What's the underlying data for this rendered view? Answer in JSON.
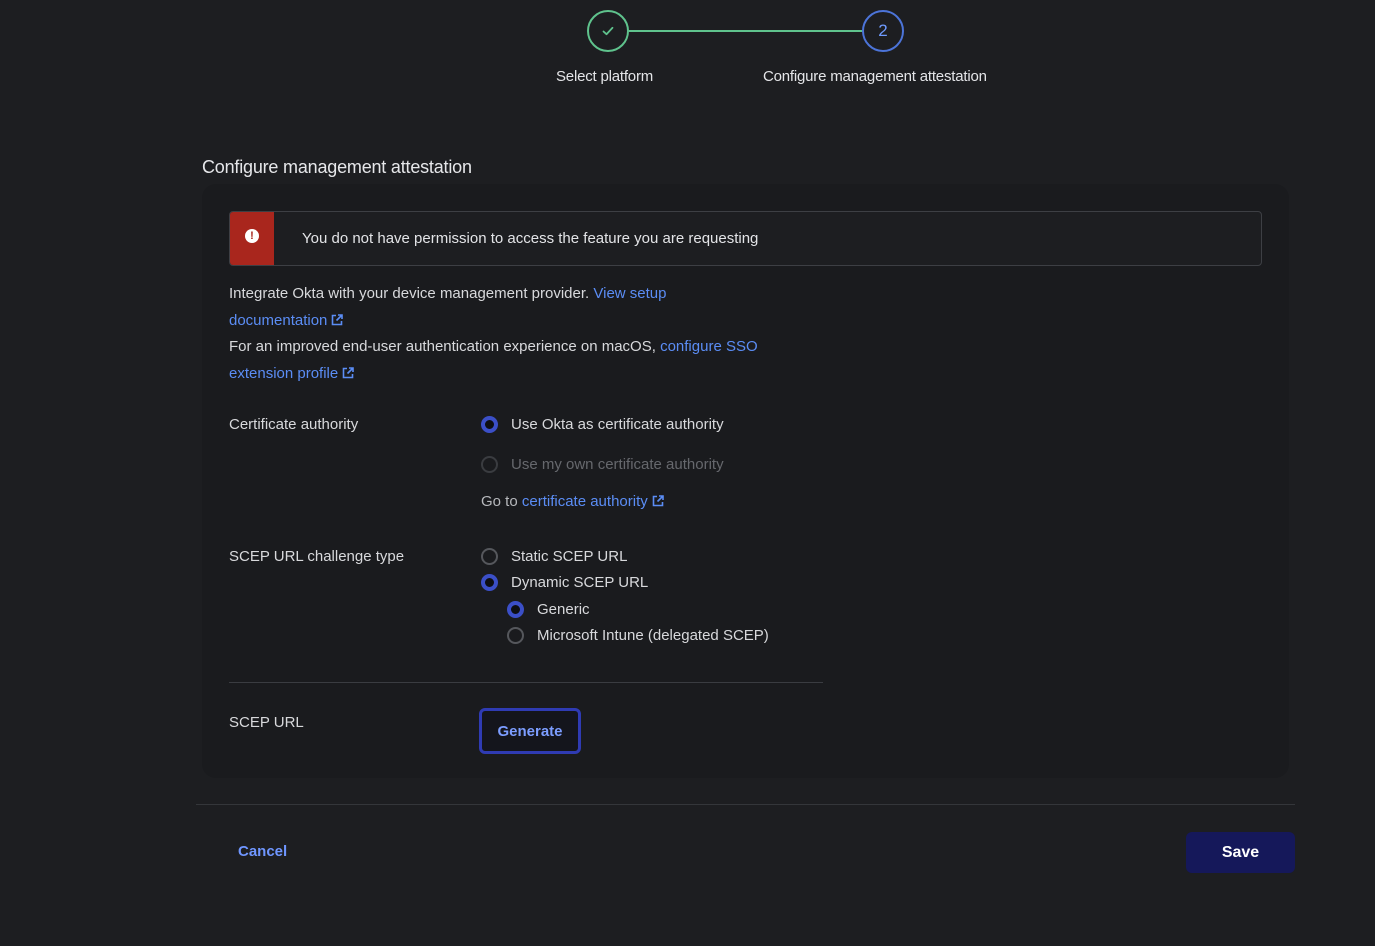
{
  "stepper": {
    "step1_label": "Select platform",
    "step2_number": "2",
    "step2_label": "Configure management attestation"
  },
  "section_title": "Configure management attestation",
  "alert": {
    "message": "You do not have permission to access the feature you are requesting"
  },
  "intro": {
    "line1_text": "Integrate Okta with your device management provider.",
    "line1_link_part1": "View setup",
    "line1_link_part2": "documentation",
    "line2_text": "For an improved end-user authentication experience on macOS,",
    "line2_link_part1": "configure SSO",
    "line2_link_part2": "extension profile"
  },
  "certificate_authority": {
    "label": "Certificate authority",
    "options": [
      {
        "label": "Use Okta as certificate authority",
        "selected": true,
        "disabled": false
      },
      {
        "label": "Use my own certificate authority",
        "selected": false,
        "disabled": true
      }
    ],
    "goto_text": "Go to",
    "goto_link": "certificate authority"
  },
  "scep_challenge": {
    "label": "SCEP URL challenge type",
    "options": [
      {
        "label": "Static SCEP URL",
        "selected": false
      },
      {
        "label": "Dynamic SCEP URL",
        "selected": true
      }
    ],
    "sub_options": [
      {
        "label": "Generic",
        "selected": true
      },
      {
        "label": "Microsoft Intune (delegated SCEP)",
        "selected": false
      }
    ]
  },
  "scep_url": {
    "label": "SCEP URL",
    "generate_label": "Generate"
  },
  "footer": {
    "cancel_label": "Cancel",
    "save_label": "Save"
  },
  "colors": {
    "accent_link": "#5b8df5",
    "alert_red": "#a9261d",
    "step_complete": "#5fc38d",
    "save_bg": "#15185a"
  }
}
